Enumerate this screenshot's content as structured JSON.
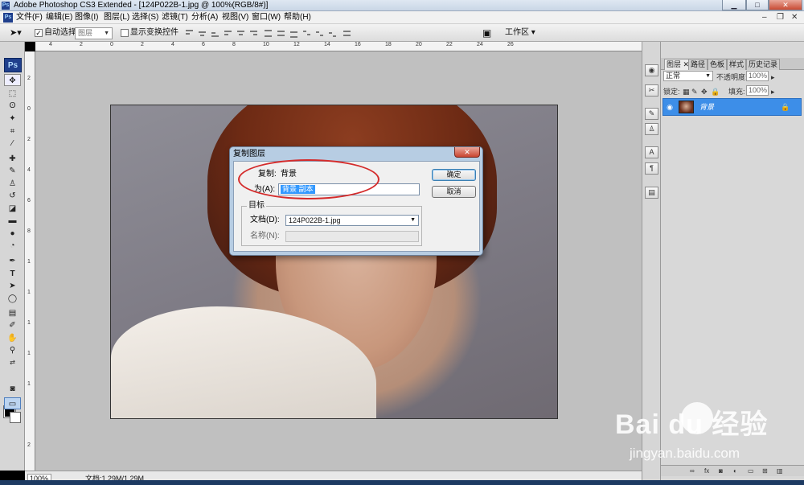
{
  "window": {
    "title": "Adobe Photoshop CS3 Extended - [124P022B-1.jpg @ 100%(RGB/8#)]",
    "app_icon": "Ps"
  },
  "menubar": {
    "items": [
      "文件(F)",
      "编辑(E)",
      "图像(I)",
      "图层(L)",
      "选择(S)",
      "滤镜(T)",
      "分析(A)",
      "视图(V)",
      "窗口(W)",
      "帮助(H)"
    ]
  },
  "options_bar": {
    "auto_select_label": "自动选择:",
    "auto_select_checked": true,
    "auto_select_target": "图层",
    "show_transform_label": "显示变换控件",
    "show_transform_checked": false,
    "workspace_label": "工作区"
  },
  "toolbox": {
    "logo": "Ps",
    "tools": [
      "move-tool",
      "marquee-tool",
      "lasso-tool",
      "magic-wand-tool",
      "crop-tool",
      "slice-tool",
      "healing-brush-tool",
      "brush-tool",
      "clone-stamp-tool",
      "history-brush-tool",
      "eraser-tool",
      "gradient-tool",
      "blur-tool",
      "dodge-tool",
      "pen-tool",
      "type-tool",
      "path-selection-tool",
      "shape-tool",
      "notes-tool",
      "eyedropper-tool",
      "hand-tool",
      "zoom-tool"
    ],
    "foreground_color": "#000000",
    "background_color": "#ffffff"
  },
  "rulers": {
    "horizontal_labels": [
      "4",
      "2",
      "0",
      "2",
      "4",
      "6",
      "8",
      "10",
      "12",
      "14",
      "16",
      "18",
      "20",
      "22",
      "24",
      "26"
    ],
    "vertical_labels": [
      "2",
      "0",
      "2",
      "4",
      "6",
      "8",
      "1",
      "1",
      "1",
      "1",
      "1",
      "2"
    ]
  },
  "document": {
    "filename": "124P022B-1.jpg",
    "zoom": "100%",
    "mode": "RGB/8#"
  },
  "statusbar": {
    "zoom": "100%",
    "doc_info": "文档:1.29M/1.29M"
  },
  "dialog": {
    "title": "复制图层",
    "duplicate_label": "复制:",
    "duplicate_value": "背景",
    "as_label": "为(A):",
    "as_value": "背景 副本",
    "ok_label": "确定",
    "cancel_label": "取消",
    "destination_legend": "目标",
    "document_label": "文档(D):",
    "document_value": "124P022B-1.jpg",
    "name_label": "名称(N):",
    "name_value": ""
  },
  "layers_panel": {
    "tabs": [
      "图层",
      "路径",
      "色板",
      "样式",
      "历史记录"
    ],
    "active_tab": "图层",
    "blend_mode": "正常",
    "opacity_label": "不透明度:",
    "opacity_value": "100%",
    "lock_label": "锁定:",
    "fill_label": "填充:",
    "fill_value": "100%",
    "layers": [
      {
        "name": "背景",
        "visible": true,
        "locked": true,
        "selected": true
      }
    ],
    "selection_color": "#3d8ee8"
  },
  "annotation": {
    "color": "#d42b2b"
  },
  "watermark": {
    "brand": "Bai du 经验",
    "url": "jingyan.baidu.com"
  }
}
